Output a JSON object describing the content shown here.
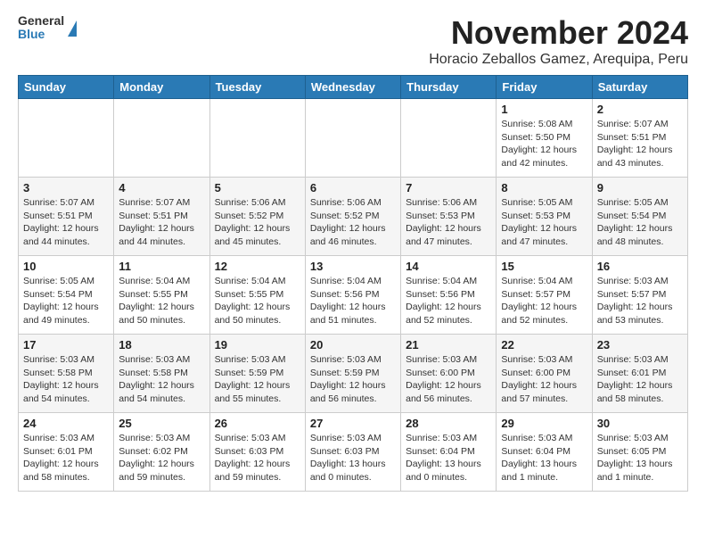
{
  "header": {
    "logo_line1": "General",
    "logo_line2": "Blue",
    "title": "November 2024",
    "subtitle": "Horacio Zeballos Gamez, Arequipa, Peru"
  },
  "days_of_week": [
    "Sunday",
    "Monday",
    "Tuesday",
    "Wednesday",
    "Thursday",
    "Friday",
    "Saturday"
  ],
  "weeks": [
    [
      {
        "day": "",
        "content": ""
      },
      {
        "day": "",
        "content": ""
      },
      {
        "day": "",
        "content": ""
      },
      {
        "day": "",
        "content": ""
      },
      {
        "day": "",
        "content": ""
      },
      {
        "day": "1",
        "content": "Sunrise: 5:08 AM\nSunset: 5:50 PM\nDaylight: 12 hours\nand 42 minutes."
      },
      {
        "day": "2",
        "content": "Sunrise: 5:07 AM\nSunset: 5:51 PM\nDaylight: 12 hours\nand 43 minutes."
      }
    ],
    [
      {
        "day": "3",
        "content": "Sunrise: 5:07 AM\nSunset: 5:51 PM\nDaylight: 12 hours\nand 44 minutes."
      },
      {
        "day": "4",
        "content": "Sunrise: 5:07 AM\nSunset: 5:51 PM\nDaylight: 12 hours\nand 44 minutes."
      },
      {
        "day": "5",
        "content": "Sunrise: 5:06 AM\nSunset: 5:52 PM\nDaylight: 12 hours\nand 45 minutes."
      },
      {
        "day": "6",
        "content": "Sunrise: 5:06 AM\nSunset: 5:52 PM\nDaylight: 12 hours\nand 46 minutes."
      },
      {
        "day": "7",
        "content": "Sunrise: 5:06 AM\nSunset: 5:53 PM\nDaylight: 12 hours\nand 47 minutes."
      },
      {
        "day": "8",
        "content": "Sunrise: 5:05 AM\nSunset: 5:53 PM\nDaylight: 12 hours\nand 47 minutes."
      },
      {
        "day": "9",
        "content": "Sunrise: 5:05 AM\nSunset: 5:54 PM\nDaylight: 12 hours\nand 48 minutes."
      }
    ],
    [
      {
        "day": "10",
        "content": "Sunrise: 5:05 AM\nSunset: 5:54 PM\nDaylight: 12 hours\nand 49 minutes."
      },
      {
        "day": "11",
        "content": "Sunrise: 5:04 AM\nSunset: 5:55 PM\nDaylight: 12 hours\nand 50 minutes."
      },
      {
        "day": "12",
        "content": "Sunrise: 5:04 AM\nSunset: 5:55 PM\nDaylight: 12 hours\nand 50 minutes."
      },
      {
        "day": "13",
        "content": "Sunrise: 5:04 AM\nSunset: 5:56 PM\nDaylight: 12 hours\nand 51 minutes."
      },
      {
        "day": "14",
        "content": "Sunrise: 5:04 AM\nSunset: 5:56 PM\nDaylight: 12 hours\nand 52 minutes."
      },
      {
        "day": "15",
        "content": "Sunrise: 5:04 AM\nSunset: 5:57 PM\nDaylight: 12 hours\nand 52 minutes."
      },
      {
        "day": "16",
        "content": "Sunrise: 5:03 AM\nSunset: 5:57 PM\nDaylight: 12 hours\nand 53 minutes."
      }
    ],
    [
      {
        "day": "17",
        "content": "Sunrise: 5:03 AM\nSunset: 5:58 PM\nDaylight: 12 hours\nand 54 minutes."
      },
      {
        "day": "18",
        "content": "Sunrise: 5:03 AM\nSunset: 5:58 PM\nDaylight: 12 hours\nand 54 minutes."
      },
      {
        "day": "19",
        "content": "Sunrise: 5:03 AM\nSunset: 5:59 PM\nDaylight: 12 hours\nand 55 minutes."
      },
      {
        "day": "20",
        "content": "Sunrise: 5:03 AM\nSunset: 5:59 PM\nDaylight: 12 hours\nand 56 minutes."
      },
      {
        "day": "21",
        "content": "Sunrise: 5:03 AM\nSunset: 6:00 PM\nDaylight: 12 hours\nand 56 minutes."
      },
      {
        "day": "22",
        "content": "Sunrise: 5:03 AM\nSunset: 6:00 PM\nDaylight: 12 hours\nand 57 minutes."
      },
      {
        "day": "23",
        "content": "Sunrise: 5:03 AM\nSunset: 6:01 PM\nDaylight: 12 hours\nand 58 minutes."
      }
    ],
    [
      {
        "day": "24",
        "content": "Sunrise: 5:03 AM\nSunset: 6:01 PM\nDaylight: 12 hours\nand 58 minutes."
      },
      {
        "day": "25",
        "content": "Sunrise: 5:03 AM\nSunset: 6:02 PM\nDaylight: 12 hours\nand 59 minutes."
      },
      {
        "day": "26",
        "content": "Sunrise: 5:03 AM\nSunset: 6:03 PM\nDaylight: 12 hours\nand 59 minutes."
      },
      {
        "day": "27",
        "content": "Sunrise: 5:03 AM\nSunset: 6:03 PM\nDaylight: 13 hours\nand 0 minutes."
      },
      {
        "day": "28",
        "content": "Sunrise: 5:03 AM\nSunset: 6:04 PM\nDaylight: 13 hours\nand 0 minutes."
      },
      {
        "day": "29",
        "content": "Sunrise: 5:03 AM\nSunset: 6:04 PM\nDaylight: 13 hours\nand 1 minute."
      },
      {
        "day": "30",
        "content": "Sunrise: 5:03 AM\nSunset: 6:05 PM\nDaylight: 13 hours\nand 1 minute."
      }
    ]
  ]
}
